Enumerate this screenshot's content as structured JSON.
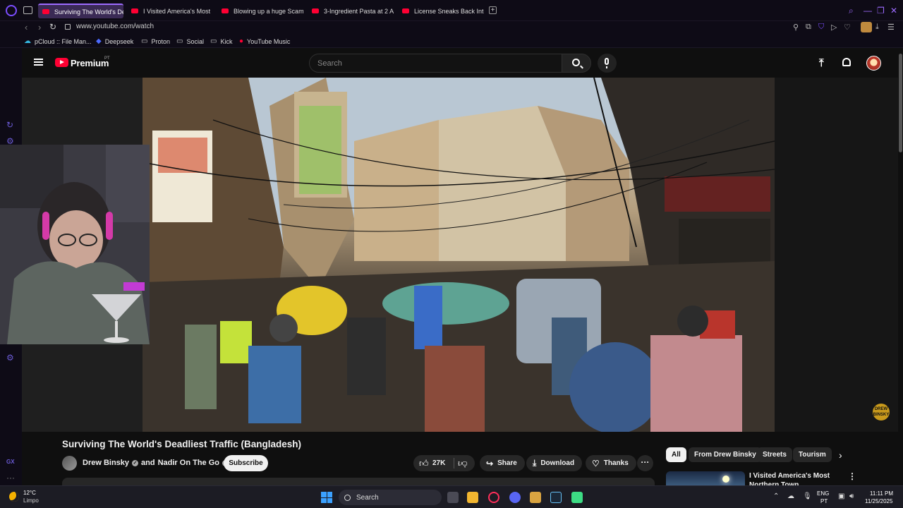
{
  "browser": {
    "tabs": [
      {
        "title": "Surviving The World's De",
        "active": true
      },
      {
        "title": "I Visited America's Most",
        "active": false
      },
      {
        "title": "Blowing up a huge Scam",
        "active": false
      },
      {
        "title": "3-Ingredient Pasta at 2 A",
        "active": false
      },
      {
        "title": "License Sneaks Back Into",
        "active": false
      }
    ],
    "new_tab_label": "+",
    "url": "www.youtube.com/watch",
    "bookmarks": [
      {
        "label": "pCloud :: File Man...",
        "icon": "cloud-icon"
      },
      {
        "label": "Deepseek",
        "icon": "whale-icon"
      },
      {
        "label": "Proton",
        "icon": "folder-icon"
      },
      {
        "label": "Social",
        "icon": "folder-icon"
      },
      {
        "label": "Kick",
        "icon": "folder-icon"
      },
      {
        "label": "YouTube Music",
        "icon": "youtube-music-icon"
      }
    ]
  },
  "youtube": {
    "brand": "Premium",
    "region": "PT",
    "search_placeholder": "Search",
    "video_title": "Surviving The World's Deadliest Traffic (Bangladesh)",
    "channel_primary": "Drew Binsky",
    "channel_joiner": "and",
    "channel_secondary": "Nadir On The Go",
    "subscribe_label": "Subscribe",
    "like_count": "27K",
    "share_label": "Share",
    "download_label": "Download",
    "thanks_label": "Thanks",
    "watermark_text": "DREW BINSKY",
    "chips": [
      "All",
      "From Drew Binsky",
      "Streets",
      "Tourism"
    ],
    "recommendation": {
      "title": "I Visited America's Most Northern Town"
    }
  },
  "taskbar": {
    "temperature": "12°C",
    "weather": "Limpo",
    "search_label": "Search",
    "language": "ENG",
    "region": "PT",
    "time": "11:11 PM",
    "date": "11/25/2025"
  },
  "colors": {
    "opera_accent": "#9d6bff",
    "youtube_red": "#ff0033",
    "background": "#0f0f0f"
  }
}
